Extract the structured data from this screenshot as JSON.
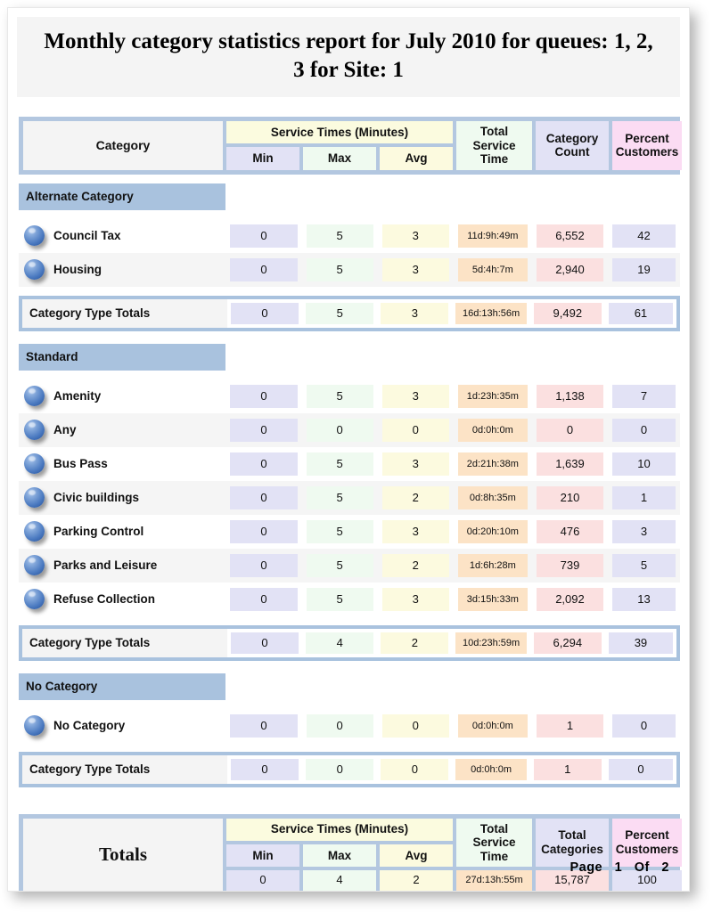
{
  "report": {
    "title": "Monthly category statistics report for July 2010 for queues:  1, 2, 3 for Site: 1"
  },
  "header": {
    "category": "Category",
    "service_times": "Service Times (Minutes)",
    "min": "Min",
    "max": "Max",
    "avg": "Avg",
    "total_service_time": "Total Service Time",
    "category_count": "Category Count",
    "percent_customers": "Percent Customers"
  },
  "totals_header": {
    "totals": "Totals",
    "service_times": "Service Times (Minutes)",
    "min": "Min",
    "max": "Max",
    "avg": "Avg",
    "total_service_time": "Total Service Time",
    "total_categories": "Total Categories",
    "percent_customers": "Percent Customers"
  },
  "totals_label_row": "Category Type Totals",
  "sections": [
    {
      "name": "Alternate Category",
      "rows": [
        {
          "label": "Council Tax",
          "min": "0",
          "max": "5",
          "avg": "3",
          "total_service_time": "11d:9h:49m",
          "count": "6,552",
          "percent": "42"
        },
        {
          "label": "Housing",
          "min": "0",
          "max": "5",
          "avg": "3",
          "total_service_time": "5d:4h:7m",
          "count": "2,940",
          "percent": "19"
        }
      ],
      "totals": {
        "label": "Category Type Totals",
        "min": "0",
        "max": "5",
        "avg": "3",
        "total_service_time": "16d:13h:56m",
        "count": "9,492",
        "percent": "61"
      }
    },
    {
      "name": "Standard",
      "rows": [
        {
          "label": "Amenity",
          "min": "0",
          "max": "5",
          "avg": "3",
          "total_service_time": "1d:23h:35m",
          "count": "1,138",
          "percent": "7"
        },
        {
          "label": "Any",
          "min": "0",
          "max": "0",
          "avg": "0",
          "total_service_time": "0d:0h:0m",
          "count": "0",
          "percent": "0"
        },
        {
          "label": "Bus Pass",
          "min": "0",
          "max": "5",
          "avg": "3",
          "total_service_time": "2d:21h:38m",
          "count": "1,639",
          "percent": "10"
        },
        {
          "label": "Civic buildings",
          "min": "0",
          "max": "5",
          "avg": "2",
          "total_service_time": "0d:8h:35m",
          "count": "210",
          "percent": "1"
        },
        {
          "label": "Parking Control",
          "min": "0",
          "max": "5",
          "avg": "3",
          "total_service_time": "0d:20h:10m",
          "count": "476",
          "percent": "3"
        },
        {
          "label": "Parks and Leisure",
          "min": "0",
          "max": "5",
          "avg": "2",
          "total_service_time": "1d:6h:28m",
          "count": "739",
          "percent": "5"
        },
        {
          "label": "Refuse Collection",
          "min": "0",
          "max": "5",
          "avg": "3",
          "total_service_time": "3d:15h:33m",
          "count": "2,092",
          "percent": "13"
        }
      ],
      "totals": {
        "label": "Category Type Totals",
        "min": "0",
        "max": "4",
        "avg": "2",
        "total_service_time": "10d:23h:59m",
        "count": "6,294",
        "percent": "39"
      }
    },
    {
      "name": "No Category",
      "rows": [
        {
          "label": "No Category",
          "min": "0",
          "max": "0",
          "avg": "0",
          "total_service_time": "0d:0h:0m",
          "count": "1",
          "percent": "0"
        }
      ],
      "totals": {
        "label": "Category Type Totals",
        "min": "0",
        "max": "0",
        "avg": "0",
        "total_service_time": "0d:0h:0m",
        "count": "1",
        "percent": "0"
      }
    }
  ],
  "grand_totals": {
    "min": "0",
    "max": "4",
    "avg": "2",
    "total_service_time": "27d:13h:55m",
    "total_categories": "15,787",
    "percent_customers": "100"
  },
  "footer": {
    "page_word": "Page",
    "page_number": "1",
    "of_word": "Of",
    "page_total": "2"
  },
  "colors": {
    "band": "#b3c7e0",
    "section": "#a9c2de",
    "min": "#e2e2f5",
    "max": "#effaf0",
    "avg": "#fcfadf",
    "total_service_time": "#fce3c6",
    "count": "#fbe0e0",
    "percent": "#e2e2f5",
    "service_times_header": "#fbfbdf",
    "percent_header": "#fbdcf3"
  }
}
